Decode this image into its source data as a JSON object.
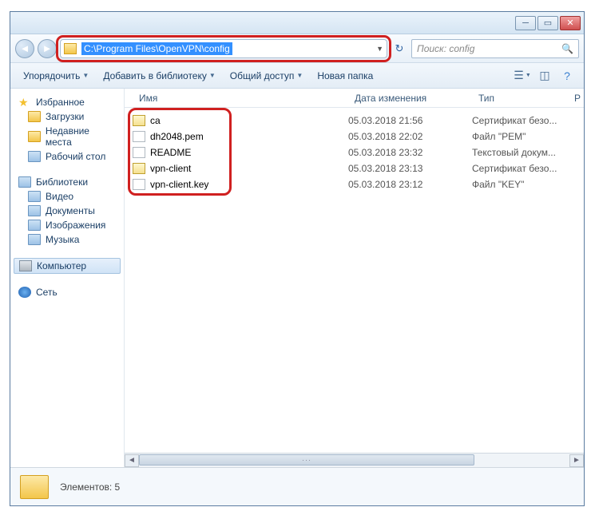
{
  "address_path": "C:\\Program Files\\OpenVPN\\config",
  "search_placeholder": "Поиск: config",
  "toolbar": {
    "organize": "Упорядочить",
    "add_to_library": "Добавить в библиотеку",
    "share": "Общий доступ",
    "new_folder": "Новая папка"
  },
  "sidebar": {
    "favorites": "Избранное",
    "downloads": "Загрузки",
    "recent": "Недавние места",
    "desktop": "Рабочий стол",
    "libraries": "Библиотеки",
    "video": "Видео",
    "documents": "Документы",
    "pictures": "Изображения",
    "music": "Музыка",
    "computer": "Компьютер",
    "network": "Сеть"
  },
  "columns": {
    "name": "Имя",
    "date": "Дата изменения",
    "type": "Тип",
    "r": "Р"
  },
  "files": [
    {
      "name": "ca",
      "date": "05.03.2018 21:56",
      "type": "Сертификат безо..."
    },
    {
      "name": "dh2048.pem",
      "date": "05.03.2018 22:02",
      "type": "Файл \"PEM\""
    },
    {
      "name": "README",
      "date": "05.03.2018 23:32",
      "type": "Текстовый докум..."
    },
    {
      "name": "vpn-client",
      "date": "05.03.2018 23:13",
      "type": "Сертификат безо..."
    },
    {
      "name": "vpn-client.key",
      "date": "05.03.2018 23:12",
      "type": "Файл \"KEY\""
    }
  ],
  "status": {
    "elements_label": "Элементов: 5"
  }
}
